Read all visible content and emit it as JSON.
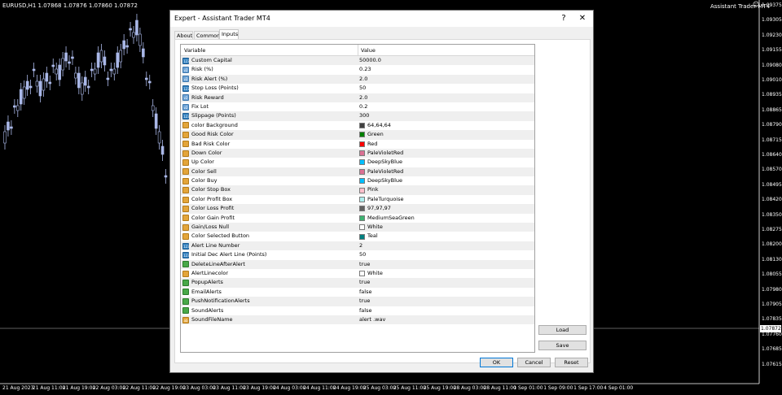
{
  "chart": {
    "header": "EURUSD,H1  1.07868 1.07876 1.07860 1.07872",
    "assistant_label": "Assistant Trader MT4",
    "assistant_icon": "smiley-icon",
    "current_price": "1.07872",
    "y_labels": [
      "1.09375",
      "1.09305",
      "1.09230",
      "1.09155",
      "1.09080",
      "1.09010",
      "1.08935",
      "1.08865",
      "1.08790",
      "1.08715",
      "1.08640",
      "1.08570",
      "1.08495",
      "1.08420",
      "1.08350",
      "1.08275",
      "1.08200",
      "1.08130",
      "1.08055",
      "1.07980",
      "1.07905",
      "1.07835",
      "1.07760",
      "1.07685",
      "1.07615"
    ],
    "x_labels": [
      "21 Aug 2023",
      "21 Aug 11:00",
      "21 Aug 19:00",
      "22 Aug 03:00",
      "22 Aug 11:00",
      "22 Aug 19:00",
      "23 Aug 03:00",
      "23 Aug 11:00",
      "23 Aug 19:00",
      "24 Aug 03:00",
      "24 Aug 11:00",
      "24 Aug 19:00",
      "25 Aug 03:00",
      "25 Aug 11:00",
      "25 Aug 19:00",
      "28 Aug 03:00",
      "28 Aug 11:00",
      "1 Sep 01:00",
      "1 Sep 09:00",
      "1 Sep 17:00",
      "4 Sep 01:00"
    ],
    "colors": {
      "background": "#000000",
      "bull": "#aab8e8",
      "bear": "#aab8e8",
      "text": "#ffffff"
    }
  },
  "dialog": {
    "title": "Expert - Assistant Trader MT4",
    "help": "?",
    "close": "✕",
    "tabs": [
      "About",
      "Common",
      "Inputs"
    ],
    "active_tab": "Inputs",
    "columns": {
      "variable": "Variable",
      "value": "Value"
    },
    "rows": [
      {
        "type": "num",
        "name": "Custom Capital",
        "value": "50000.0"
      },
      {
        "type": "dbl",
        "name": "Risk (%)",
        "value": "0.23"
      },
      {
        "type": "dbl",
        "name": "Risk Alert (%)",
        "value": "2.0"
      },
      {
        "type": "num",
        "name": "Stop Loss (Points)",
        "value": "50"
      },
      {
        "type": "dbl",
        "name": "Risk Reward",
        "value": "2.0"
      },
      {
        "type": "dbl",
        "name": "Fix Lot",
        "value": "0.2"
      },
      {
        "type": "num",
        "name": "Slippage (Points)",
        "value": "300"
      },
      {
        "type": "col",
        "name": "color Background",
        "value": "64,64,64",
        "swatch": "#404040"
      },
      {
        "type": "col",
        "name": "Good Risk Color",
        "value": "Green",
        "swatch": "#008000"
      },
      {
        "type": "col",
        "name": "Bad Risk Color",
        "value": "Red",
        "swatch": "#ff0000"
      },
      {
        "type": "col",
        "name": "Down Color",
        "value": "PaleVioletRed",
        "swatch": "#db7093"
      },
      {
        "type": "col",
        "name": "Up Color",
        "value": "DeepSkyBlue",
        "swatch": "#00bfff"
      },
      {
        "type": "col",
        "name": "Color Sell",
        "value": "PaleVioletRed",
        "swatch": "#db7093"
      },
      {
        "type": "col",
        "name": "Color Buy",
        "value": "DeepSkyBlue",
        "swatch": "#00bfff"
      },
      {
        "type": "col",
        "name": "Color Stop Box",
        "value": "Pink",
        "swatch": "#ffc0cb"
      },
      {
        "type": "col",
        "name": "Color Profit Box",
        "value": "PaleTurquoise",
        "swatch": "#afeeee"
      },
      {
        "type": "col",
        "name": "Color Loss Profit",
        "value": "97,97,97",
        "swatch": "#616161"
      },
      {
        "type": "col",
        "name": "Color Gain Profit",
        "value": "MediumSeaGreen",
        "swatch": "#3cb371"
      },
      {
        "type": "col",
        "name": "Gain/Loss Null",
        "value": "White",
        "swatch": "#ffffff"
      },
      {
        "type": "col",
        "name": "Color Selected Button",
        "value": "Teal",
        "swatch": "#008080"
      },
      {
        "type": "num",
        "name": "Alert Line Number",
        "value": "2"
      },
      {
        "type": "num",
        "name": "Initial Dec Alert Line (Points)",
        "value": "50"
      },
      {
        "type": "bool",
        "name": "DeleteLineAfterAlert",
        "value": "true"
      },
      {
        "type": "col",
        "name": "AlertLinecolor",
        "value": "White",
        "swatch": "#ffffff"
      },
      {
        "type": "bool",
        "name": "PopupAlerts",
        "value": "true"
      },
      {
        "type": "bool",
        "name": "EmailAlerts",
        "value": "false"
      },
      {
        "type": "bool",
        "name": "PushNotificationAlerts",
        "value": "true"
      },
      {
        "type": "bool",
        "name": "SoundAlerts",
        "value": "false"
      },
      {
        "type": "str",
        "name": "SoundFileName",
        "value": "alert .wav"
      }
    ],
    "buttons": {
      "load": "Load",
      "save": "Save",
      "ok": "OK",
      "cancel": "Cancel",
      "reset": "Reset"
    }
  }
}
